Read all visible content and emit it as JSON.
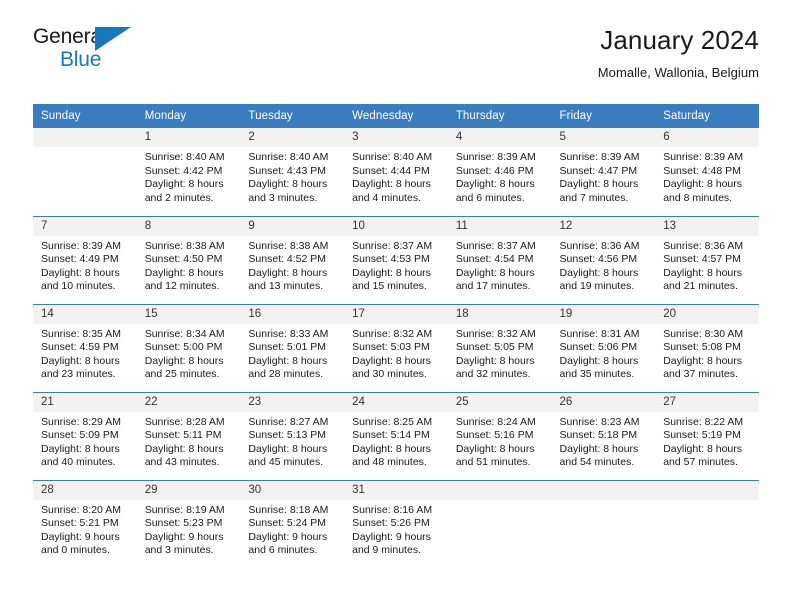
{
  "logo": {
    "word_dark": "General",
    "word_blue": "Blue",
    "triangle_color": "#1878be"
  },
  "header": {
    "title": "January 2024",
    "subtitle": "Momalle, Wallonia, Belgium"
  },
  "theme": {
    "header_blue": "#3a7cbe",
    "daynum_band": "#f2f2f2",
    "text": "#1a1a1a"
  },
  "calendar": {
    "weekday_headers": [
      "Sunday",
      "Monday",
      "Tuesday",
      "Wednesday",
      "Thursday",
      "Friday",
      "Saturday"
    ],
    "weeks": [
      [
        {
          "day": "",
          "empty": true,
          "sunrise": "",
          "sunset": "",
          "daylight_1": "",
          "daylight_2": ""
        },
        {
          "day": "1",
          "sunrise": "Sunrise: 8:40 AM",
          "sunset": "Sunset: 4:42 PM",
          "daylight_1": "Daylight: 8 hours",
          "daylight_2": "and 2 minutes."
        },
        {
          "day": "2",
          "sunrise": "Sunrise: 8:40 AM",
          "sunset": "Sunset: 4:43 PM",
          "daylight_1": "Daylight: 8 hours",
          "daylight_2": "and 3 minutes."
        },
        {
          "day": "3",
          "sunrise": "Sunrise: 8:40 AM",
          "sunset": "Sunset: 4:44 PM",
          "daylight_1": "Daylight: 8 hours",
          "daylight_2": "and 4 minutes."
        },
        {
          "day": "4",
          "sunrise": "Sunrise: 8:39 AM",
          "sunset": "Sunset: 4:46 PM",
          "daylight_1": "Daylight: 8 hours",
          "daylight_2": "and 6 minutes."
        },
        {
          "day": "5",
          "sunrise": "Sunrise: 8:39 AM",
          "sunset": "Sunset: 4:47 PM",
          "daylight_1": "Daylight: 8 hours",
          "daylight_2": "and 7 minutes."
        },
        {
          "day": "6",
          "sunrise": "Sunrise: 8:39 AM",
          "sunset": "Sunset: 4:48 PM",
          "daylight_1": "Daylight: 8 hours",
          "daylight_2": "and 8 minutes."
        }
      ],
      [
        {
          "day": "7",
          "sunrise": "Sunrise: 8:39 AM",
          "sunset": "Sunset: 4:49 PM",
          "daylight_1": "Daylight: 8 hours",
          "daylight_2": "and 10 minutes."
        },
        {
          "day": "8",
          "sunrise": "Sunrise: 8:38 AM",
          "sunset": "Sunset: 4:50 PM",
          "daylight_1": "Daylight: 8 hours",
          "daylight_2": "and 12 minutes."
        },
        {
          "day": "9",
          "sunrise": "Sunrise: 8:38 AM",
          "sunset": "Sunset: 4:52 PM",
          "daylight_1": "Daylight: 8 hours",
          "daylight_2": "and 13 minutes."
        },
        {
          "day": "10",
          "sunrise": "Sunrise: 8:37 AM",
          "sunset": "Sunset: 4:53 PM",
          "daylight_1": "Daylight: 8 hours",
          "daylight_2": "and 15 minutes."
        },
        {
          "day": "11",
          "sunrise": "Sunrise: 8:37 AM",
          "sunset": "Sunset: 4:54 PM",
          "daylight_1": "Daylight: 8 hours",
          "daylight_2": "and 17 minutes."
        },
        {
          "day": "12",
          "sunrise": "Sunrise: 8:36 AM",
          "sunset": "Sunset: 4:56 PM",
          "daylight_1": "Daylight: 8 hours",
          "daylight_2": "and 19 minutes."
        },
        {
          "day": "13",
          "sunrise": "Sunrise: 8:36 AM",
          "sunset": "Sunset: 4:57 PM",
          "daylight_1": "Daylight: 8 hours",
          "daylight_2": "and 21 minutes."
        }
      ],
      [
        {
          "day": "14",
          "sunrise": "Sunrise: 8:35 AM",
          "sunset": "Sunset: 4:59 PM",
          "daylight_1": "Daylight: 8 hours",
          "daylight_2": "and 23 minutes."
        },
        {
          "day": "15",
          "sunrise": "Sunrise: 8:34 AM",
          "sunset": "Sunset: 5:00 PM",
          "daylight_1": "Daylight: 8 hours",
          "daylight_2": "and 25 minutes."
        },
        {
          "day": "16",
          "sunrise": "Sunrise: 8:33 AM",
          "sunset": "Sunset: 5:01 PM",
          "daylight_1": "Daylight: 8 hours",
          "daylight_2": "and 28 minutes."
        },
        {
          "day": "17",
          "sunrise": "Sunrise: 8:32 AM",
          "sunset": "Sunset: 5:03 PM",
          "daylight_1": "Daylight: 8 hours",
          "daylight_2": "and 30 minutes."
        },
        {
          "day": "18",
          "sunrise": "Sunrise: 8:32 AM",
          "sunset": "Sunset: 5:05 PM",
          "daylight_1": "Daylight: 8 hours",
          "daylight_2": "and 32 minutes."
        },
        {
          "day": "19",
          "sunrise": "Sunrise: 8:31 AM",
          "sunset": "Sunset: 5:06 PM",
          "daylight_1": "Daylight: 8 hours",
          "daylight_2": "and 35 minutes."
        },
        {
          "day": "20",
          "sunrise": "Sunrise: 8:30 AM",
          "sunset": "Sunset: 5:08 PM",
          "daylight_1": "Daylight: 8 hours",
          "daylight_2": "and 37 minutes."
        }
      ],
      [
        {
          "day": "21",
          "sunrise": "Sunrise: 8:29 AM",
          "sunset": "Sunset: 5:09 PM",
          "daylight_1": "Daylight: 8 hours",
          "daylight_2": "and 40 minutes."
        },
        {
          "day": "22",
          "sunrise": "Sunrise: 8:28 AM",
          "sunset": "Sunset: 5:11 PM",
          "daylight_1": "Daylight: 8 hours",
          "daylight_2": "and 43 minutes."
        },
        {
          "day": "23",
          "sunrise": "Sunrise: 8:27 AM",
          "sunset": "Sunset: 5:13 PM",
          "daylight_1": "Daylight: 8 hours",
          "daylight_2": "and 45 minutes."
        },
        {
          "day": "24",
          "sunrise": "Sunrise: 8:25 AM",
          "sunset": "Sunset: 5:14 PM",
          "daylight_1": "Daylight: 8 hours",
          "daylight_2": "and 48 minutes."
        },
        {
          "day": "25",
          "sunrise": "Sunrise: 8:24 AM",
          "sunset": "Sunset: 5:16 PM",
          "daylight_1": "Daylight: 8 hours",
          "daylight_2": "and 51 minutes."
        },
        {
          "day": "26",
          "sunrise": "Sunrise: 8:23 AM",
          "sunset": "Sunset: 5:18 PM",
          "daylight_1": "Daylight: 8 hours",
          "daylight_2": "and 54 minutes."
        },
        {
          "day": "27",
          "sunrise": "Sunrise: 8:22 AM",
          "sunset": "Sunset: 5:19 PM",
          "daylight_1": "Daylight: 8 hours",
          "daylight_2": "and 57 minutes."
        }
      ],
      [
        {
          "day": "28",
          "sunrise": "Sunrise: 8:20 AM",
          "sunset": "Sunset: 5:21 PM",
          "daylight_1": "Daylight: 9 hours",
          "daylight_2": "and 0 minutes."
        },
        {
          "day": "29",
          "sunrise": "Sunrise: 8:19 AM",
          "sunset": "Sunset: 5:23 PM",
          "daylight_1": "Daylight: 9 hours",
          "daylight_2": "and 3 minutes."
        },
        {
          "day": "30",
          "sunrise": "Sunrise: 8:18 AM",
          "sunset": "Sunset: 5:24 PM",
          "daylight_1": "Daylight: 9 hours",
          "daylight_2": "and 6 minutes."
        },
        {
          "day": "31",
          "sunrise": "Sunrise: 8:16 AM",
          "sunset": "Sunset: 5:26 PM",
          "daylight_1": "Daylight: 9 hours",
          "daylight_2": "and 9 minutes."
        },
        {
          "day": "",
          "empty": true,
          "sunrise": "",
          "sunset": "",
          "daylight_1": "",
          "daylight_2": ""
        },
        {
          "day": "",
          "empty": true,
          "sunrise": "",
          "sunset": "",
          "daylight_1": "",
          "daylight_2": ""
        },
        {
          "day": "",
          "empty": true,
          "sunrise": "",
          "sunset": "",
          "daylight_1": "",
          "daylight_2": ""
        }
      ]
    ]
  }
}
